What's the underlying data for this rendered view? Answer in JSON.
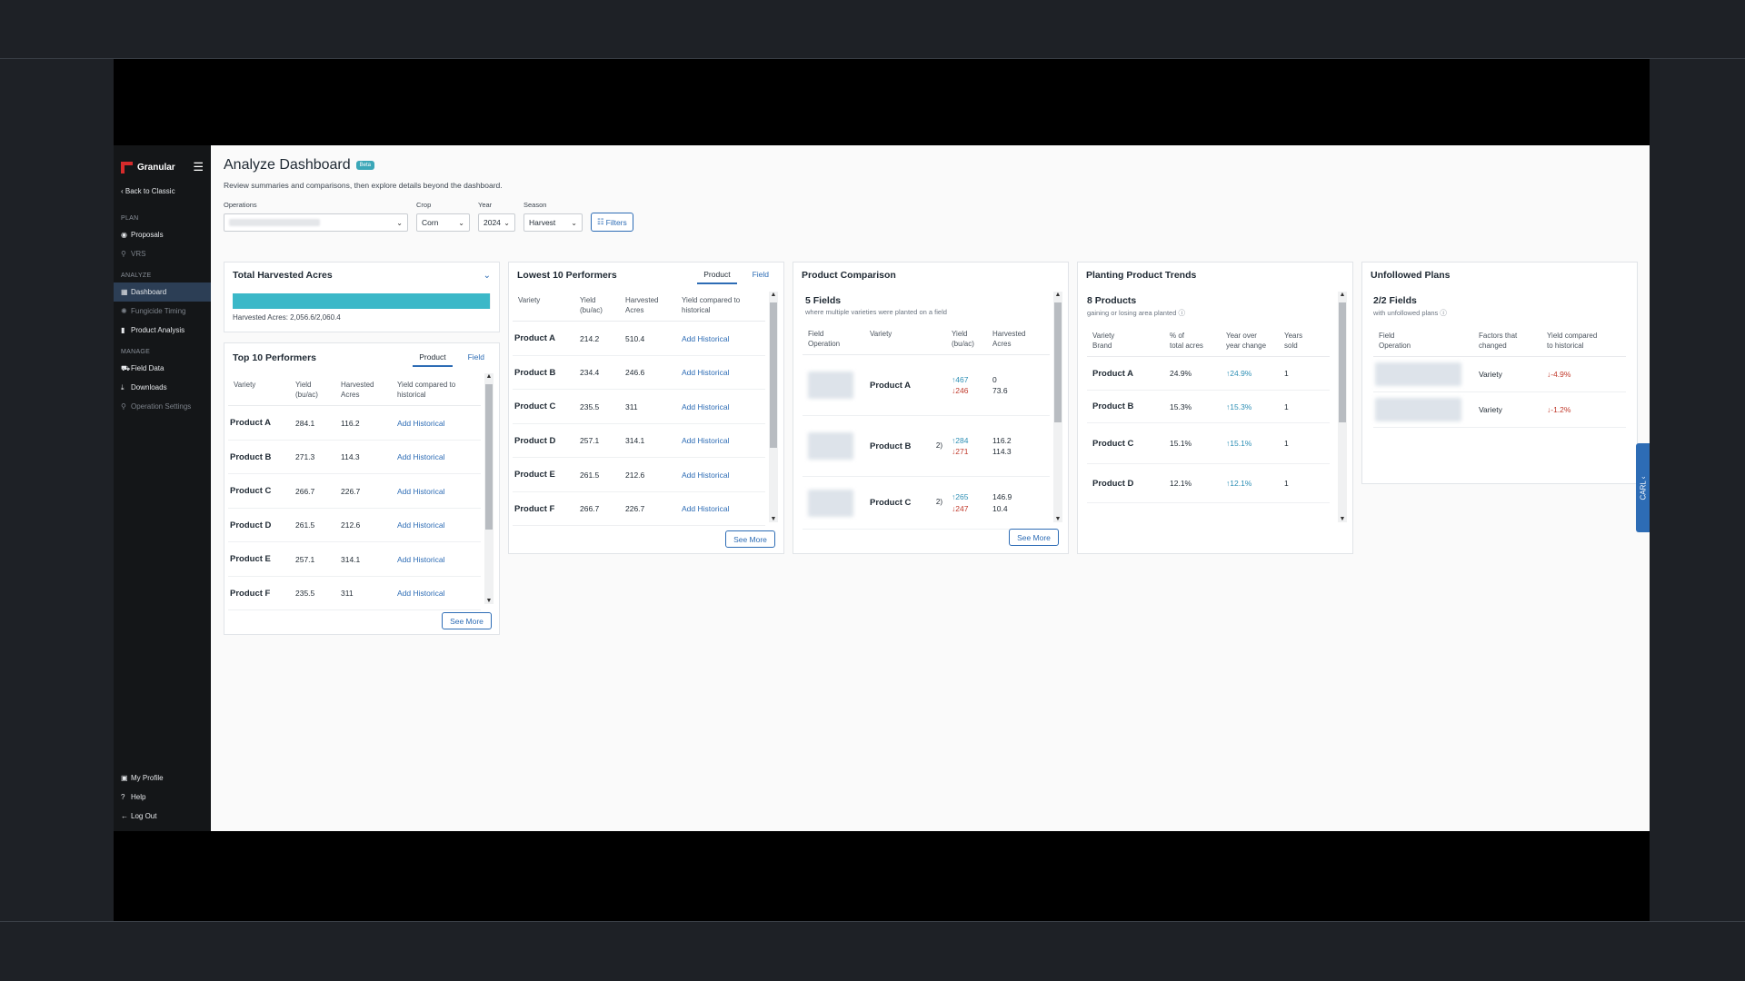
{
  "app": {
    "logo_text": "Granular",
    "back_link": "Back to Classic"
  },
  "sidebar": {
    "sections": [
      {
        "label": "PLAN",
        "items": [
          {
            "label": "Proposals",
            "icon": "pin-icon",
            "state": "normal"
          },
          {
            "label": "VRS",
            "icon": "person-icon",
            "state": "dim"
          }
        ]
      },
      {
        "label": "ANALYZE",
        "items": [
          {
            "label": "Dashboard",
            "icon": "dashboard-icon",
            "state": "active"
          },
          {
            "label": "Fungicide Timing",
            "icon": "spray-icon",
            "state": "dim"
          },
          {
            "label": "Product Analysis",
            "icon": "bar-chart-icon",
            "state": "normal"
          }
        ]
      },
      {
        "label": "MANAGE",
        "items": [
          {
            "label": "Field Data",
            "icon": "tractor-icon",
            "state": "normal"
          },
          {
            "label": "Downloads",
            "icon": "download-icon",
            "state": "normal"
          },
          {
            "label": "Operation Settings",
            "icon": "person-icon",
            "state": "dim"
          }
        ]
      }
    ],
    "bottom": [
      {
        "label": "My Profile",
        "icon": "profile-icon"
      },
      {
        "label": "Help",
        "icon": "help-icon"
      },
      {
        "label": "Log Out",
        "icon": "logout-icon"
      }
    ]
  },
  "header": {
    "title": "Analyze Dashboard",
    "badge": "Beta",
    "subtitle": "Review summaries and comparisons, then explore details beyond the dashboard."
  },
  "filters": {
    "operations_label": "Operations",
    "crop_label": "Crop",
    "crop_value": "Corn",
    "year_label": "Year",
    "year_value": "2024",
    "season_label": "Season",
    "season_value": "Harvest",
    "filters_button": "Filters"
  },
  "total_acres": {
    "title": "Total Harvested Acres",
    "progress": 0.998,
    "bar_color": "#3bb8c8",
    "caption": "Harvested Acres: 2,056.6/2,060.4"
  },
  "top10": {
    "title": "Top 10 Performers",
    "tabs": [
      "Product",
      "Field"
    ],
    "headers": [
      "Variety",
      "Yield\n(bu/ac)",
      "Harvested\nAcres",
      "Yield compared to\nhistorical"
    ],
    "rows": [
      {
        "name": "Product A",
        "yield": "284.1",
        "acres": "116.2",
        "action": "Add Historical"
      },
      {
        "name": "Product B",
        "yield": "271.3",
        "acres": "114.3",
        "action": "Add Historical"
      },
      {
        "name": "Product C",
        "yield": "266.7",
        "acres": "226.7",
        "action": "Add Historical"
      },
      {
        "name": "Product D",
        "yield": "261.5",
        "acres": "212.6",
        "action": "Add Historical"
      },
      {
        "name": "Product E",
        "yield": "257.1",
        "acres": "314.1",
        "action": "Add Historical"
      },
      {
        "name": "Product F",
        "yield": "235.5",
        "acres": "311",
        "action": "Add Historical"
      }
    ],
    "see_more": "See More"
  },
  "lowest10": {
    "title": "Lowest 10 Performers",
    "tabs": [
      "Product",
      "Field"
    ],
    "headers": [
      "Variety",
      "Yield\n(bu/ac)",
      "Harvested\nAcres",
      "Yield compared to\nhistorical"
    ],
    "rows": [
      {
        "name": "Product A",
        "yield": "214.2",
        "acres": "510.4",
        "action": "Add Historical"
      },
      {
        "name": "Product B",
        "yield": "234.4",
        "acres": "246.6",
        "action": "Add Historical"
      },
      {
        "name": "Product C",
        "yield": "235.5",
        "acres": "311",
        "action": "Add Historical"
      },
      {
        "name": "Product D",
        "yield": "257.1",
        "acres": "314.1",
        "action": "Add Historical"
      },
      {
        "name": "Product E",
        "yield": "261.5",
        "acres": "212.6",
        "action": "Add Historical"
      },
      {
        "name": "Product F",
        "yield": "266.7",
        "acres": "226.7",
        "action": "Add Historical"
      }
    ],
    "see_more": "See More"
  },
  "comparison": {
    "title": "Product Comparison",
    "count": "5 Fields",
    "count_sub": "where multiple varieties were planted on a field",
    "headers": [
      "Field\nOperation",
      "Variety",
      "Yield\n(bu/ac)",
      "Harvested\nAcres"
    ],
    "rows": [
      {
        "name": "Product A",
        "prefix": "",
        "y1": "467",
        "y2": "246",
        "a1": "0",
        "a2": "73.6"
      },
      {
        "name": "Product B",
        "prefix": "2)",
        "y1": "284",
        "y2": "271",
        "a1": "116.2",
        "a2": "114.3"
      },
      {
        "name": "Product C",
        "prefix": "2)",
        "y1": "265",
        "y2": "247",
        "a1": "146.9",
        "a2": "10.4"
      }
    ],
    "see_more": "See More"
  },
  "trends": {
    "title": "Planting Product Trends",
    "count": "8 Products",
    "count_sub": "gaining or losing area planted",
    "headers": [
      "Variety\nBrand",
      "% of\ntotal acres",
      "Year over\nyear change",
      "Years\nsold"
    ],
    "rows": [
      {
        "name": "Product A",
        "pct": "24.9%",
        "change": "24.9%",
        "years": "1"
      },
      {
        "name": "Product B",
        "pct": "15.3%",
        "change": "15.3%",
        "years": "1"
      },
      {
        "name": "Product C",
        "pct": "15.1%",
        "change": "15.1%",
        "years": "1"
      },
      {
        "name": "Product D",
        "pct": "12.1%",
        "change": "12.1%",
        "years": "1"
      }
    ]
  },
  "unfollowed": {
    "title": "Unfollowed Plans",
    "count": "2/2 Fields",
    "count_sub": "with unfollowed plans",
    "headers": [
      "Field\nOperation",
      "Factors that\nchanged",
      "Yield compared\nto historical"
    ],
    "rows": [
      {
        "factor": "Variety",
        "change": "-4.9%"
      },
      {
        "factor": "Variety",
        "change": "-1.2%"
      }
    ]
  },
  "carl_tab": "CARL"
}
